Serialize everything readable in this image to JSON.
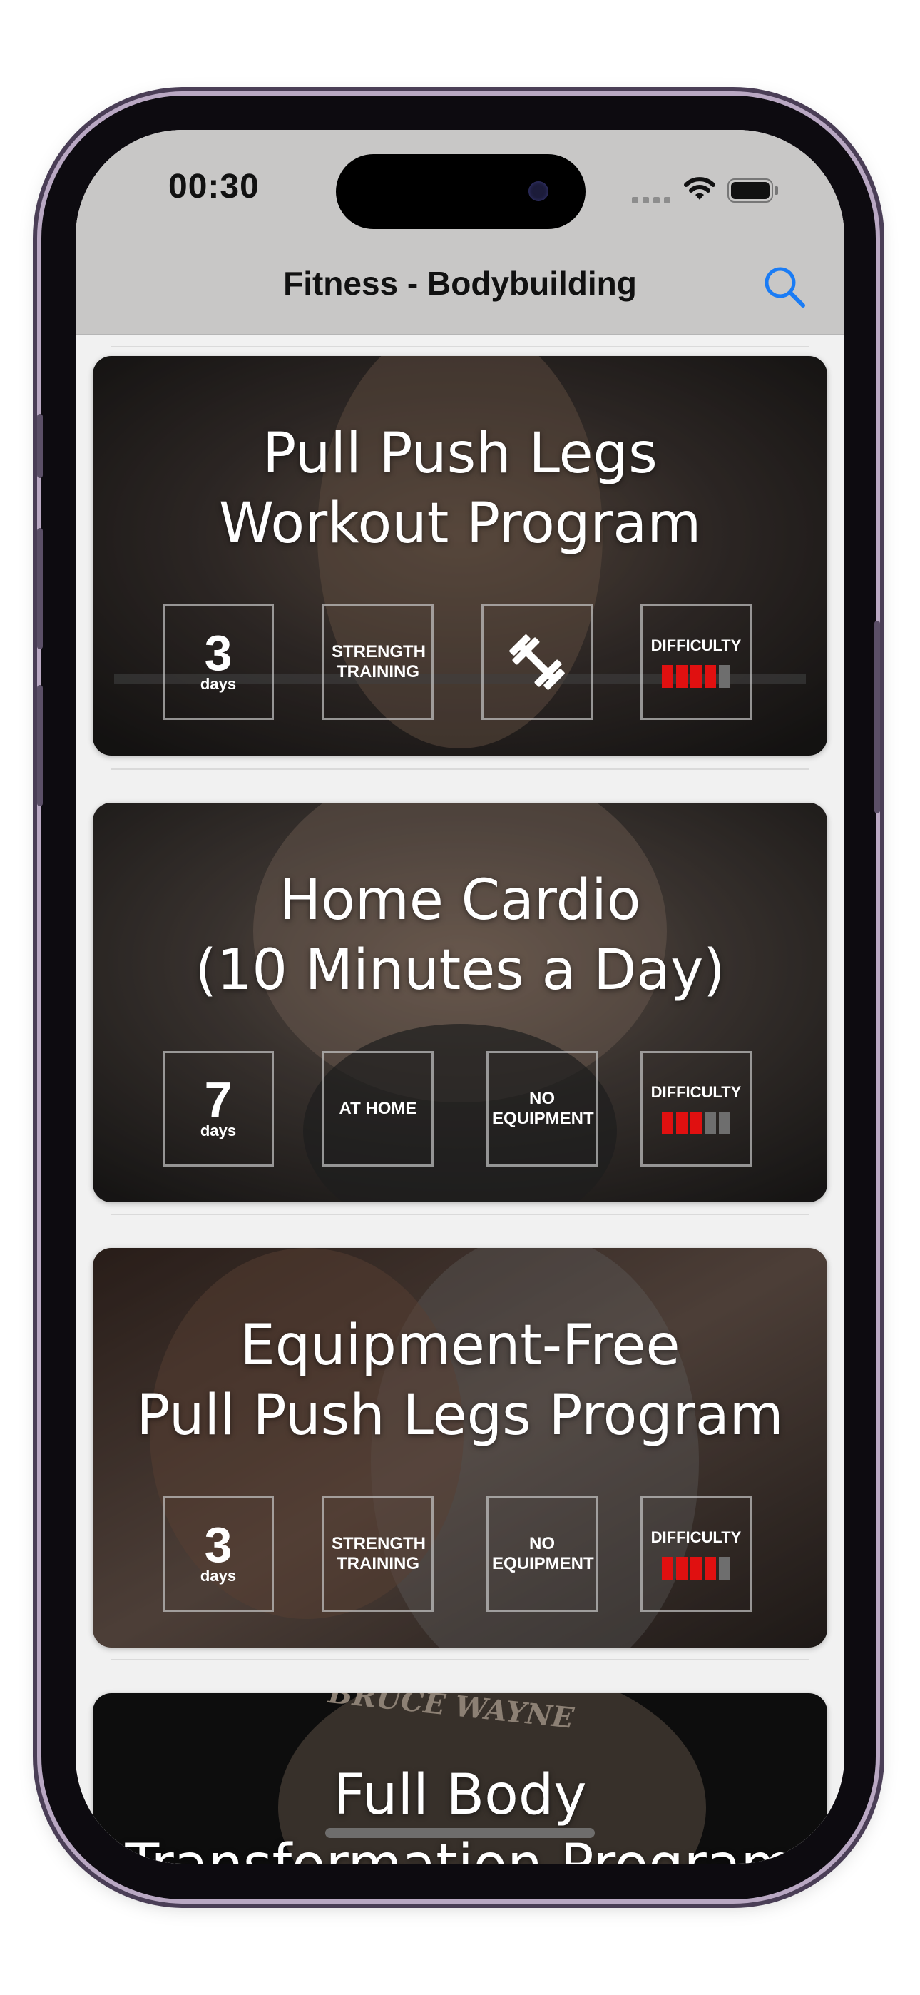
{
  "status_bar": {
    "time": "00:30"
  },
  "nav": {
    "title": "Fitness - Bodybuilding"
  },
  "colors": {
    "accent": "#1a7cf5",
    "difficulty_on": "#e01010",
    "difficulty_off": "#6e6e6e"
  },
  "programs": [
    {
      "title_line1": "Pull Push Legs",
      "title_line2": "Workout Program",
      "duration_number": "3",
      "duration_unit": "days",
      "type_label": "STRENGTH TRAINING",
      "equipment_icon": "dumbbell-icon",
      "difficulty_label": "DIFFICULTY",
      "difficulty_level": 4,
      "difficulty_max": 5
    },
    {
      "title_line1": "Home Cardio",
      "title_line2": "(10 Minutes a Day)",
      "duration_number": "7",
      "duration_unit": "days",
      "type_label": "AT HOME",
      "equipment_label": "NO EQUIPMENT",
      "difficulty_label": "DIFFICULTY",
      "difficulty_level": 3,
      "difficulty_max": 5
    },
    {
      "title_line1": "Equipment-Free",
      "title_line2": "Pull Push Legs Program",
      "duration_number": "3",
      "duration_unit": "days",
      "type_label": "STRENGTH TRAINING",
      "equipment_label": "NO EQUIPMENT",
      "difficulty_label": "DIFFICULTY",
      "difficulty_level": 4,
      "difficulty_max": 5
    },
    {
      "title_line1": "Full Body",
      "title_line2": "Transformation Program",
      "background_text": "BRUCE WAYNE"
    }
  ]
}
